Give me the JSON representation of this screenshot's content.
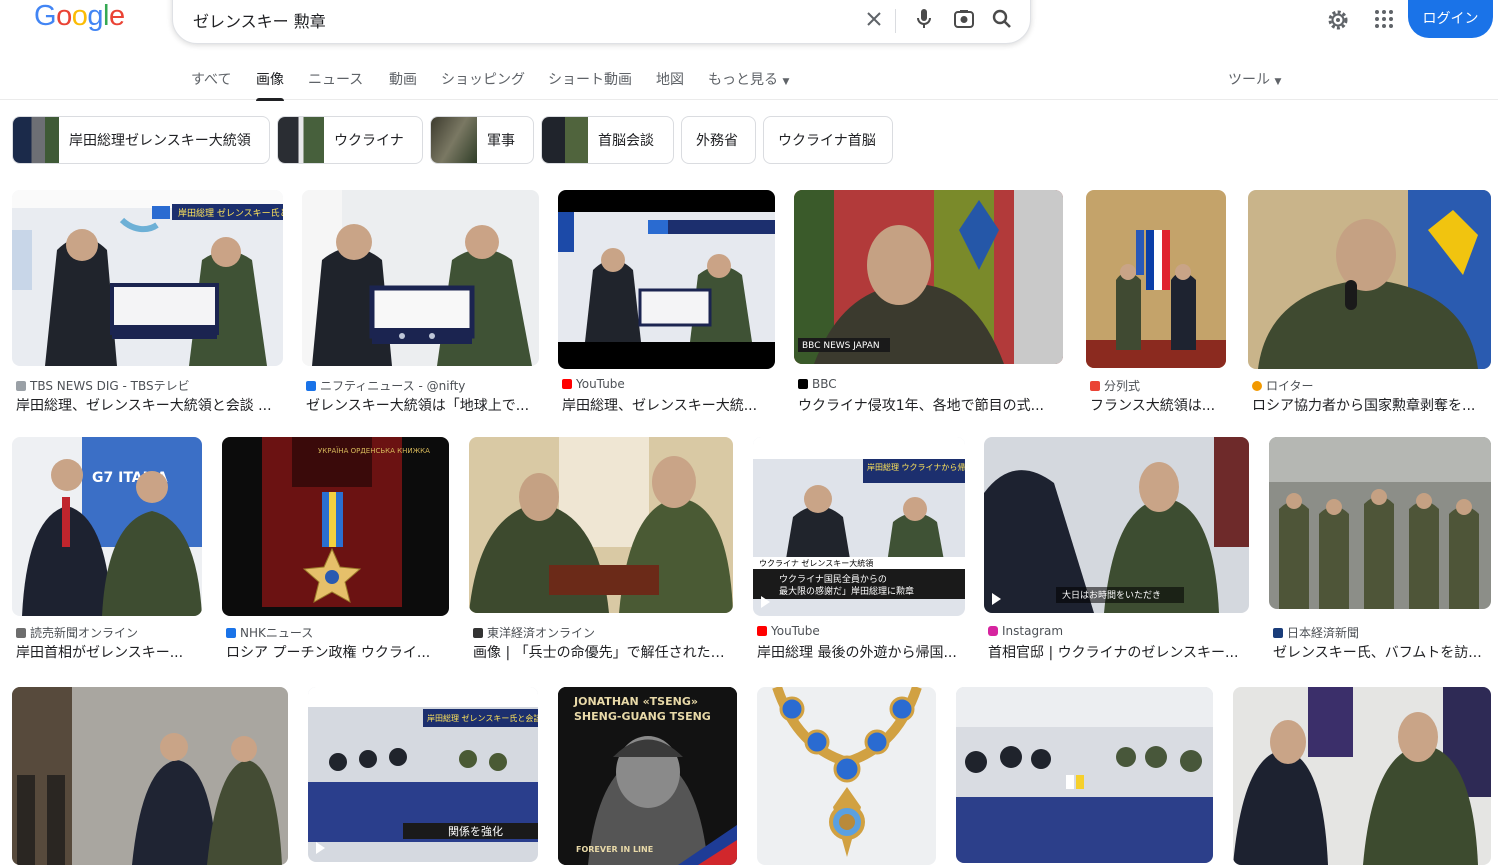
{
  "logo": "Google",
  "search": {
    "query": "ゼレンスキー 勲章"
  },
  "header": {
    "login": "ログイン"
  },
  "tabs": [
    "すべて",
    "画像",
    "ニュース",
    "動画",
    "ショッピング",
    "ショート動画",
    "地図",
    "もっと見る"
  ],
  "tools": "ツール",
  "chips": [
    "岸田総理ゼレンスキー大統領",
    "ウクライナ",
    "軍事",
    "首脳会談",
    "外務省",
    "ウクライナ首脳"
  ],
  "results": [
    {
      "source": "TBS NEWS DIG - TBSテレビ",
      "title": "岸田総理、ゼレンスキー大統領と会談 ..."
    },
    {
      "source": "ニフティニュース - @nifty",
      "title": "ゼレンスキー大統領は「地球上で..."
    },
    {
      "source": "YouTube",
      "title": "岸田総理、ゼレンスキー大統..."
    },
    {
      "source": "BBC",
      "title": "ウクライナ侵攻1年、各地で節目の式..."
    },
    {
      "source": "分列式",
      "title": "フランス大統領は..."
    },
    {
      "source": "ロイター",
      "title": "ロシア協力者から国家勲章剥奪を..."
    },
    {
      "source": "読売新聞オンライン",
      "title": "岸田首相がゼレンスキー..."
    },
    {
      "source": "NHKニュース",
      "title": "ロシア プーチン政権 ウクライ..."
    },
    {
      "source": "東洋経済オンライン",
      "title": "画像 | 「兵士の命優先」で解任されたウ..."
    },
    {
      "source": "YouTube",
      "title": "岸田総理 最後の外遊から帰国..."
    },
    {
      "source": "Instagram",
      "title": "首相官邸 | ウクライナのゼレンスキー..."
    },
    {
      "source": "日本経済新聞",
      "title": "ゼレンスキー氏、バフムトを訪..."
    }
  ],
  "overlays": {
    "r1_caption": "岸田総理 ゼレンスキー氏と会談",
    "r4_badge": "BBC NEWS JAPAN",
    "r7_sign": "G7 ITALIA",
    "r8_book": "УКРАЇНА ОРДЕНСЬКА КНИЖКА",
    "r10_top": "岸田総理 ウクライナから帰国",
    "r10_sub1": "ウクライナ ゼレンスキー大統領",
    "r10_sub2": "ウクライナ国民全員からの",
    "r10_sub3": "最大限の感謝だ」岸田総理に勲章",
    "r11_caption": "大日はお時間をいただき",
    "r14_top": "岸田総理 ゼレンスキー氏と会談",
    "r14_bottom": "関係を強化",
    "r15_name1": "JONATHAN «TSENG»",
    "r15_name2": "SHENG-GUANG TSENG",
    "r15_footer": "FOREVER IN LINE"
  },
  "colors": {
    "accent": "#1a73e8"
  }
}
